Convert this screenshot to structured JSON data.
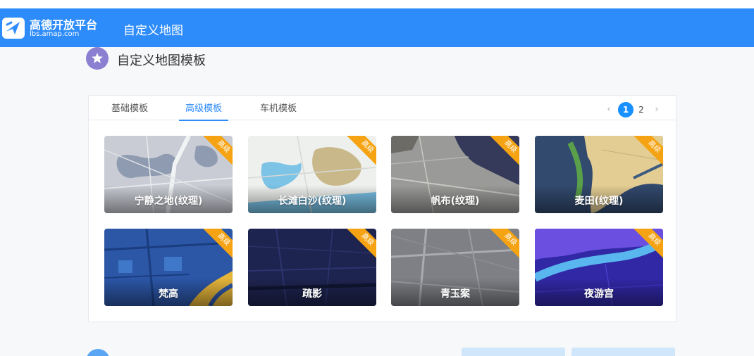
{
  "brand": {
    "name": "高德开放平台",
    "sub": "lbs.amap.com",
    "color": "#2e8cfa"
  },
  "nav": {
    "title": "自定义地图"
  },
  "section": {
    "title": "自定义地图模板",
    "icon": "star-icon",
    "icon_color": "#8a7fd0"
  },
  "tabs": [
    {
      "label": "基础模板",
      "active": false
    },
    {
      "label": "高级模板",
      "active": true
    },
    {
      "label": "车机模板",
      "active": false
    }
  ],
  "pagination": {
    "prev": "‹",
    "pages": [
      "1",
      "2"
    ],
    "current": "1",
    "next": "›"
  },
  "ribbon_label": "高级",
  "ribbon_color": "#f5a312",
  "templates": [
    {
      "name": "宁静之地(纹理)",
      "theme": "light-grey"
    },
    {
      "name": "长滩白沙(纹理)",
      "theme": "sand"
    },
    {
      "name": "帆布(纹理)",
      "theme": "canvas"
    },
    {
      "name": "麦田(纹理)",
      "theme": "wheat"
    },
    {
      "name": "梵高",
      "theme": "blue-gogh"
    },
    {
      "name": "疏影",
      "theme": "dark-navy"
    },
    {
      "name": "青玉案",
      "theme": "grey"
    },
    {
      "name": "夜游宫",
      "theme": "purple-night"
    }
  ]
}
